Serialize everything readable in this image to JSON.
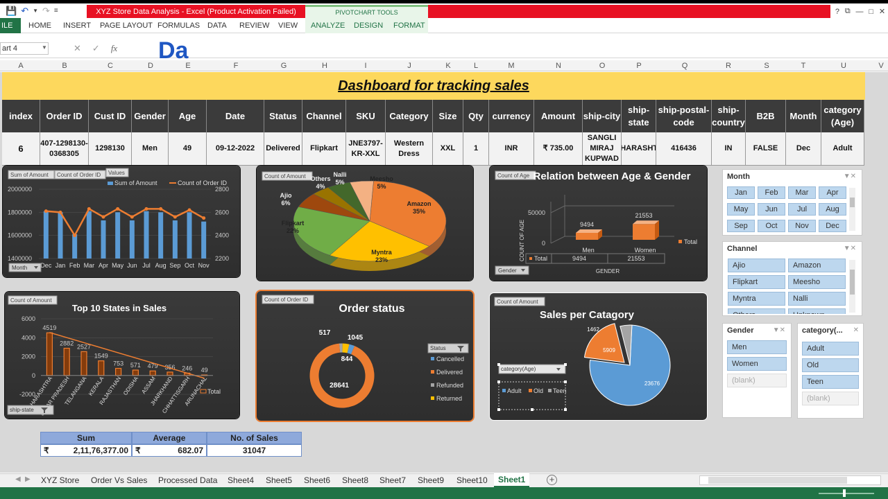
{
  "window": {
    "title": "XYZ Store Data Analysis - Excel (Product Activation Failed)",
    "context_tab_group": "PIVOTCHART TOOLS",
    "controls": [
      "?",
      "⧉",
      "—",
      "□",
      "✕"
    ]
  },
  "ribbon": {
    "file_label": "ILE",
    "tabs": [
      "HOME",
      "INSERT",
      "PAGE LAYOUT",
      "FORMULAS",
      "DATA",
      "REVIEW",
      "VIEW"
    ],
    "context_tabs": [
      "ANALYZE",
      "DESIGN",
      "FORMAT"
    ]
  },
  "formula_bar": {
    "name_box": "art 4",
    "fx": "fx",
    "value": "Da"
  },
  "columns": [
    "A",
    "B",
    "C",
    "D",
    "E",
    "F",
    "G",
    "H",
    "I",
    "J",
    "K",
    "L",
    "M",
    "N",
    "O",
    "P",
    "Q",
    "R",
    "S",
    "T",
    "U",
    "V"
  ],
  "banner": "Dashboard for tracking sales",
  "record_table": {
    "headers": [
      "index",
      "Order ID",
      "Cust ID",
      "Gender",
      "Age",
      "Date",
      "Status",
      "Channel",
      "SKU",
      "Category",
      "Size",
      "Qty",
      "currency",
      "Amount",
      "ship-city",
      "ship-state",
      "ship-postal-code",
      "ship-country",
      "B2B",
      "Month",
      "category (Age)"
    ],
    "row": [
      "6",
      "407-1298130-0368305",
      "1298130",
      "Men",
      "49",
      "09-12-2022",
      "Delivered",
      "Flipkart",
      "JNE3797-KR-XXL",
      "Western Dress",
      "XXL",
      "1",
      "INR",
      "₹ 735.00",
      "SANGLI MIRAJ KUPWAD",
      "MAHARASHTRA",
      "416436",
      "IN",
      "FALSE",
      "Dec",
      "Adult"
    ]
  },
  "chart_monthly": {
    "buttons": [
      "Sum of Amount",
      "Count of Order ID",
      "Values",
      "Month"
    ],
    "chart_data": {
      "type": "bar",
      "categories": [
        "Dec",
        "Jan",
        "Feb",
        "Mar",
        "Apr",
        "May",
        "Jun",
        "Jul",
        "Aug",
        "Sep",
        "Oct",
        "Nov"
      ],
      "series": [
        {
          "name": "Sum of Amount",
          "type": "bar",
          "axis": "left",
          "values": [
            1810000,
            1800000,
            1610000,
            1810000,
            1730000,
            1800000,
            1730000,
            1810000,
            1800000,
            1730000,
            1800000,
            1720000
          ],
          "color": "#5b9bd5"
        },
        {
          "name": "Count of Order ID",
          "type": "line",
          "axis": "right",
          "values": [
            2610,
            2600,
            2400,
            2630,
            2560,
            2630,
            2560,
            2630,
            2630,
            2560,
            2620,
            2550
          ],
          "color": "#ed7d31"
        }
      ],
      "ylim_left": [
        1400000,
        2000000
      ],
      "ylim_right": [
        2200,
        2800
      ],
      "yticks_left": [
        "2000000",
        "1800000",
        "1600000",
        "1400000"
      ],
      "yticks_right": [
        "2800",
        "2600",
        "2400",
        "2200"
      ],
      "legend": "top"
    }
  },
  "chart_channel": {
    "button": "Count of Amount",
    "chart_data": {
      "type": "pie",
      "slices": [
        {
          "label": "Amazon",
          "value": 35,
          "text": "35%",
          "color": "#ed7d31"
        },
        {
          "label": "Myntra",
          "value": 23,
          "text": "23%",
          "color": "#ffc000"
        },
        {
          "label": "Flipkart",
          "value": 22,
          "text": "22%",
          "color": "#70ad47"
        },
        {
          "label": "Ajio",
          "value": 6,
          "text": "6%",
          "color": "#9e480e"
        },
        {
          "label": "Others",
          "value": 4,
          "text": "4%",
          "color": "#997300"
        },
        {
          "label": "Nalli",
          "value": 5,
          "text": "5%",
          "color": "#43682b"
        },
        {
          "label": "Meesho",
          "value": 5,
          "text": "5%",
          "color": "#f4b183"
        }
      ]
    }
  },
  "chart_age_gender": {
    "button": "Count of Age",
    "title": "Relation between Age & Gender",
    "gender_button": "Gender",
    "chart_data": {
      "type": "bar",
      "categories": [
        "Men",
        "Women"
      ],
      "values": [
        9494,
        21553
      ],
      "series_name": "Total",
      "ylabel": "COUNT OF AGE",
      "xlabel": "GENDER",
      "ylim": [
        0,
        50000
      ],
      "yticks": [
        "50000",
        "0"
      ],
      "data_table": {
        "row_label": "Total",
        "values": [
          "9494",
          "21553"
        ]
      }
    }
  },
  "chart_states": {
    "button": "Count of Amount",
    "title": "Top 10 States in Sales",
    "state_button": "ship-state",
    "chart_data": {
      "type": "bar",
      "categories": [
        "MAHARASHTRA",
        "UTTAR PRADESH",
        "TELANGANA",
        "KERALA",
        "RAJASTHAN",
        "ODISHA",
        "ASSAM",
        "JHARKHAND",
        "CHHATTISGARH",
        "ARUNACHAL"
      ],
      "values": [
        4519,
        2882,
        2527,
        1549,
        753,
        571,
        479,
        356,
        246,
        49
      ],
      "value_labels": [
        "4519",
        "2882",
        "2527",
        "1549",
        "753",
        "571",
        "479",
        "356",
        "246",
        "49"
      ],
      "ylim": [
        -2000,
        6000
      ],
      "yticks": [
        "6000",
        "4000",
        "2000",
        "0",
        "-2000"
      ],
      "series_name": "Total",
      "trendline": true
    }
  },
  "chart_status": {
    "button": "Count of Order ID",
    "title": "Order status",
    "status_button": "Status",
    "chart_data": {
      "type": "pie",
      "subtype": "doughnut",
      "slices": [
        {
          "label": "Cancelled",
          "value": 844,
          "color": "#5b9bd5"
        },
        {
          "label": "Delivered",
          "value": 28641,
          "color": "#ed7d31"
        },
        {
          "label": "Refunded",
          "value": 517,
          "color": "#a5a5a5"
        },
        {
          "label": "Returned",
          "value": 1045,
          "color": "#ffc000"
        }
      ],
      "legend": "right"
    }
  },
  "chart_category": {
    "button": "Count of Amount",
    "title": "Sales per Catagory",
    "category_button": "category(Age)",
    "chart_data": {
      "type": "pie",
      "slices": [
        {
          "label": "Adult",
          "value": 23676,
          "text": "23676",
          "color": "#5b9bd5"
        },
        {
          "label": "Old",
          "value": 5909,
          "text": "5909",
          "color": "#ed7d31"
        },
        {
          "label": "Teen",
          "value": 1462,
          "text": "1462",
          "color": "#a5a5a5"
        }
      ],
      "legend": "bottom-left"
    }
  },
  "slicers": {
    "month": {
      "title": "Month",
      "items": [
        "Jan",
        "Feb",
        "Mar",
        "Apr",
        "May",
        "Jun",
        "Jul",
        "Aug",
        "Sep",
        "Oct",
        "Nov",
        "Dec"
      ]
    },
    "channel": {
      "title": "Channel",
      "items": [
        "Ajio",
        "Amazon",
        "Flipkart",
        "Meesho",
        "Myntra",
        "Nalli",
        "Others",
        "Unknown"
      ]
    },
    "gender": {
      "title": "Gender",
      "items": [
        "Men",
        "Women",
        "(blank)"
      ]
    },
    "category": {
      "title": "category(...",
      "items": [
        "Adult",
        "Old",
        "Teen",
        "(blank)"
      ]
    }
  },
  "summary": {
    "headers": [
      "Sum",
      "Average",
      "No. of Sales"
    ],
    "currency": "₹",
    "sum": "2,11,76,377.00",
    "average": "682.07",
    "count": "31047"
  },
  "sheet_tabs": [
    "XYZ Store",
    "Order Vs Sales",
    "Processed Data",
    "Sheet4",
    "Sheet5",
    "Sheet6",
    "Sheet8",
    "Sheet7",
    "Sheet9",
    "Sheet10",
    "Sheet1"
  ],
  "active_sheet": "Sheet1",
  "colors": {
    "excel_green": "#217346",
    "title_red": "#e81123",
    "banner_yellow": "#fdd85d",
    "header_dark": "#3b3b3b",
    "slicer_blue": "#bdd7ee"
  }
}
